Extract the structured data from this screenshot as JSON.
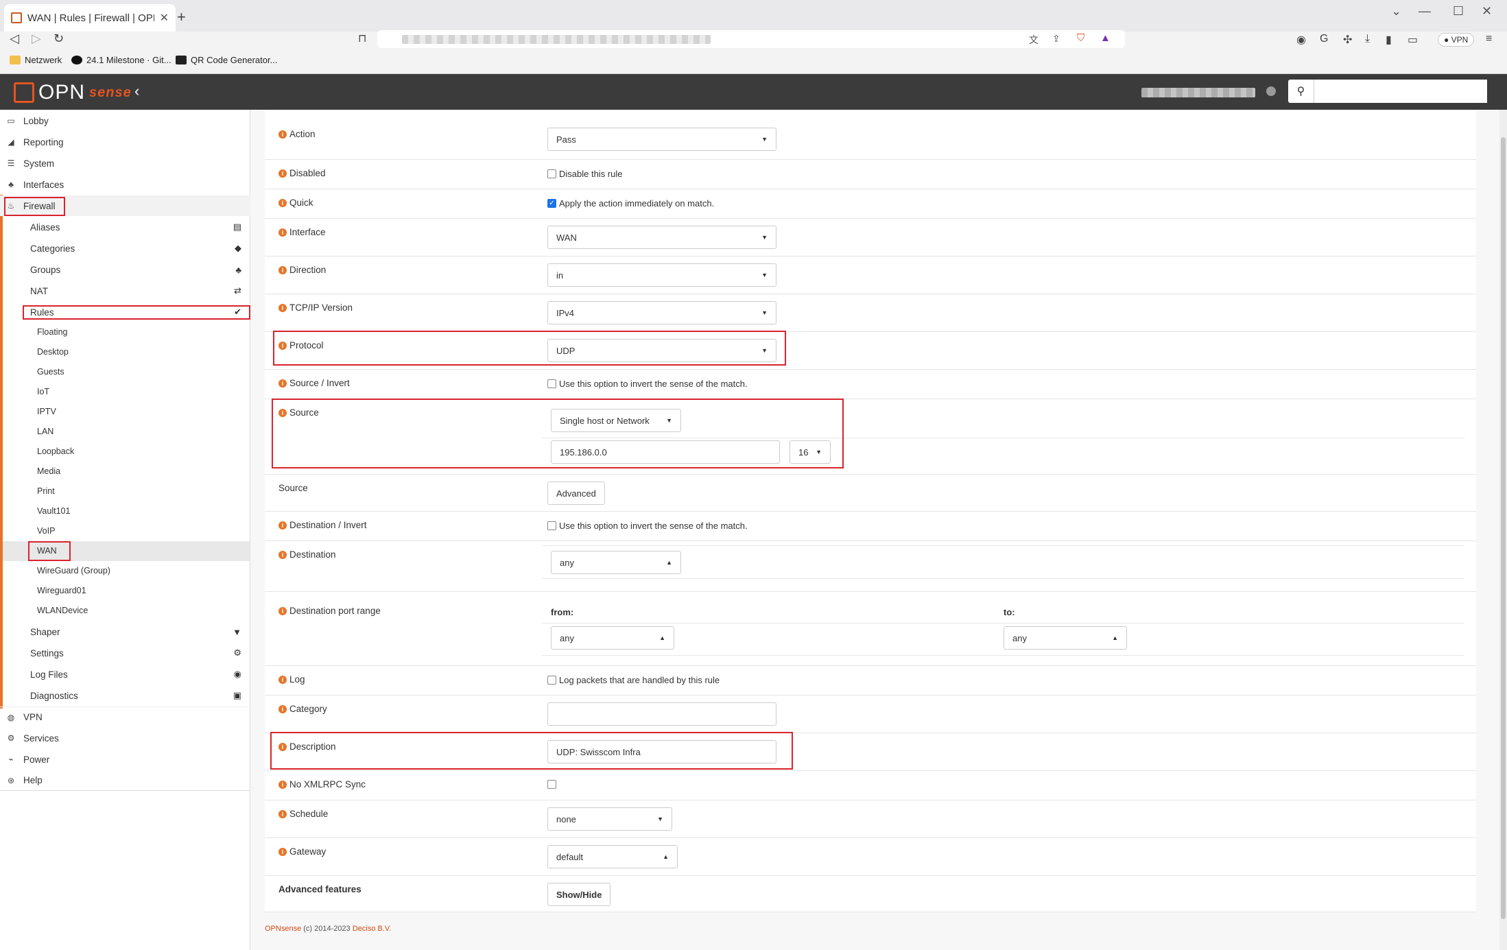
{
  "browser": {
    "tab_title": "WAN | Rules | Firewall | OPNsense",
    "bookmarks": [
      "Netzwerk",
      "24.1 Milestone · Git...",
      "QR Code Generator..."
    ],
    "vpn_label": "VPN"
  },
  "header": {
    "logo_text": "OPN",
    "logo_suffix": "sense",
    "collapse_icon": "chevron-left",
    "search_placeholder": ""
  },
  "sidebar": {
    "main_items": [
      "Lobby",
      "Reporting",
      "System",
      "Interfaces",
      "Firewall"
    ],
    "firewall_items": [
      "Aliases",
      "Categories",
      "Groups",
      "NAT",
      "Rules"
    ],
    "rules_items": [
      "Floating",
      "Desktop",
      "Guests",
      "IoT",
      "IPTV",
      "LAN",
      "Loopback",
      "Media",
      "Print",
      "Vault101",
      "VoIP",
      "WAN",
      "WireGuard (Group)",
      "Wireguard01",
      "WLANDevice"
    ],
    "firewall_items_2": [
      "Shaper",
      "Settings",
      "Log Files",
      "Diagnostics"
    ],
    "bottom_items": [
      "VPN",
      "Services",
      "Power",
      "Help"
    ]
  },
  "form": {
    "action_label": "Action",
    "action_value": "Pass",
    "disabled_label": "Disabled",
    "disabled_text": "Disable this rule",
    "quick_label": "Quick",
    "quick_text": "Apply the action immediately on match.",
    "interface_label": "Interface",
    "interface_value": "WAN",
    "direction_label": "Direction",
    "direction_value": "in",
    "tcpip_label": "TCP/IP Version",
    "tcpip_value": "IPv4",
    "protocol_label": "Protocol",
    "protocol_value": "UDP",
    "source_invert_label": "Source / Invert",
    "source_invert_text": "Use this option to invert the sense of the match.",
    "source_label": "Source",
    "source_type": "Single host or Network",
    "source_address": "195.186.0.0",
    "source_mask": "16",
    "source_adv_label": "Source",
    "advanced_button": "Advanced",
    "dest_invert_label": "Destination / Invert",
    "dest_invert_text": "Use this option to invert the sense of the match.",
    "destination_label": "Destination",
    "destination_value": "any",
    "dest_port_label": "Destination port range",
    "from_label": "from:",
    "to_label": "to:",
    "from_value": "any",
    "to_value": "any",
    "log_label": "Log",
    "log_text": "Log packets that are handled by this rule",
    "category_label": "Category",
    "category_value": "",
    "description_label": "Description",
    "description_value": "UDP: Swisscom Infra",
    "noxmlrpc_label": "No XMLRPC Sync",
    "schedule_label": "Schedule",
    "schedule_value": "none",
    "gateway_label": "Gateway",
    "gateway_value": "default",
    "advanced_features_label": "Advanced features",
    "showhide_button": "Show/Hide"
  },
  "footer": {
    "brand": "OPNsense",
    "copyright": " (c) 2014-2023 ",
    "company": "Deciso B.V."
  }
}
